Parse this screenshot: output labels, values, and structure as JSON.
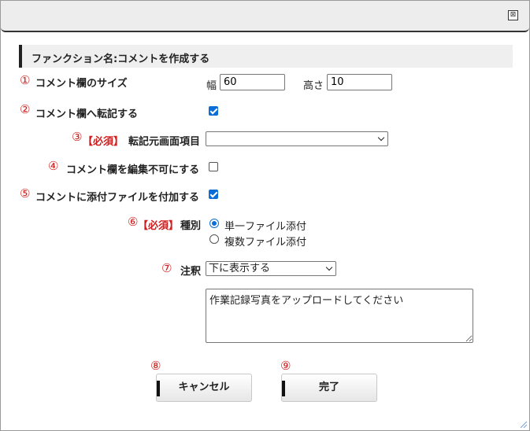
{
  "dialog": {
    "close_glyph": "⊠",
    "section_title": "ファンクション名:コメントを作成する"
  },
  "row1": {
    "num": "①",
    "label": "コメント欄のサイズ",
    "width_label": "幅",
    "width_value": "60",
    "height_label": "高さ",
    "height_value": "10"
  },
  "row2": {
    "num": "②",
    "label": "コメント欄へ転記する",
    "checked": true
  },
  "row3": {
    "num": "③",
    "required": "【必須】",
    "label": "転記元画面項目",
    "value": ""
  },
  "row4": {
    "num": "④",
    "label": "コメント欄を編集不可にする",
    "checked": false
  },
  "row5": {
    "num": "⑤",
    "label": "コメントに添付ファイルを付加する",
    "checked": true
  },
  "row6": {
    "num": "⑥",
    "required": "【必須】",
    "label": "種別",
    "options": [
      "単一ファイル添付",
      "複数ファイル添付"
    ],
    "selected": "単一ファイル添付"
  },
  "row7": {
    "num": "⑦",
    "label": "注釈",
    "select_value": "下に表示する",
    "annotation_text": "作業記録写真をアップロードしてください"
  },
  "buttons": {
    "cancel_num": "⑧",
    "cancel_label": "キャンセル",
    "ok_num": "⑨",
    "ok_label": "完了"
  },
  "colors": {
    "accent": "#0b6ed6",
    "required_red": "#d01c1c",
    "section_bg": "#efefef"
  }
}
